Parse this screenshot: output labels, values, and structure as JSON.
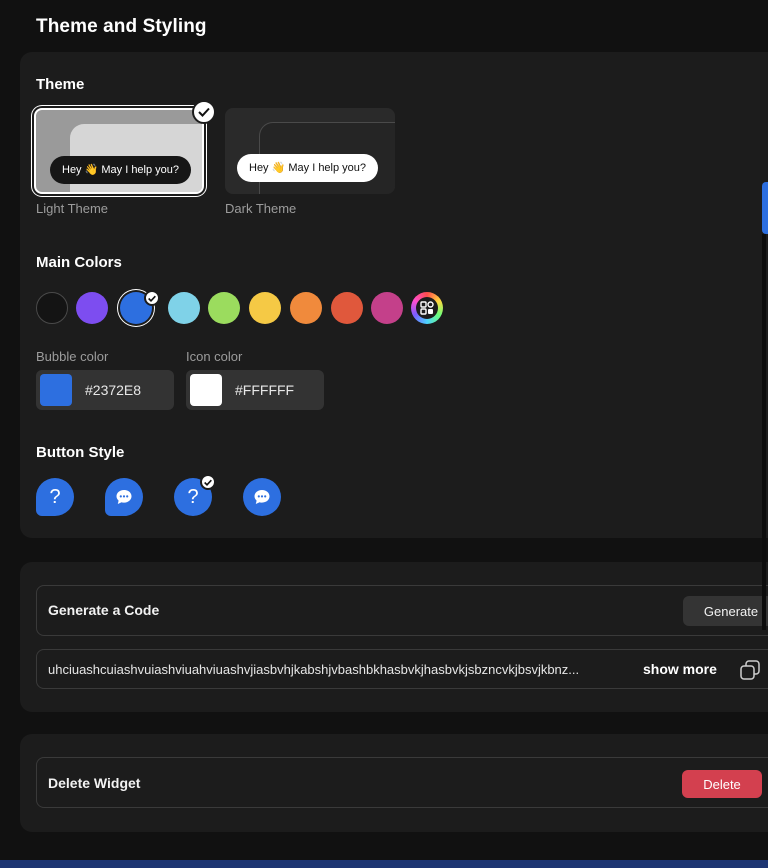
{
  "page": {
    "title": "Theme and Styling"
  },
  "theme_section": {
    "title": "Theme",
    "options": [
      {
        "label": "Light Theme",
        "bubble_text": "Hey 👋 May I help you?",
        "selected": true
      },
      {
        "label": "Dark Theme",
        "bubble_text": "Hey 👋 May I help you?",
        "selected": false
      }
    ]
  },
  "main_colors": {
    "title": "Main Colors",
    "swatches": [
      {
        "name": "black",
        "color": "#141414"
      },
      {
        "name": "purple",
        "color": "#7d4df0"
      },
      {
        "name": "blue",
        "color": "#2d6fe0",
        "selected": true
      },
      {
        "name": "light-blue",
        "color": "#7fd2e8"
      },
      {
        "name": "light-green",
        "color": "#9bdc5e"
      },
      {
        "name": "yellow",
        "color": "#f5c945"
      },
      {
        "name": "orange",
        "color": "#f08a3c"
      },
      {
        "name": "red-orange",
        "color": "#e0583c"
      },
      {
        "name": "pink",
        "color": "#c4408a"
      },
      {
        "name": "custom-color-picker",
        "icon": "palette-icon"
      }
    ],
    "bubble_color": {
      "label": "Bubble color",
      "value": "#2372E8",
      "swatch": "#2d6fe0"
    },
    "icon_color": {
      "label": "Icon color",
      "value": "#FFFFFF",
      "swatch": "#FFFFFF"
    }
  },
  "button_style": {
    "title": "Button Style",
    "options": [
      {
        "icon": "question-icon",
        "shape": "tail",
        "selected": false
      },
      {
        "icon": "chat-icon",
        "shape": "tail",
        "selected": false
      },
      {
        "icon": "question-icon",
        "shape": "round",
        "selected": true
      },
      {
        "icon": "chat-icon",
        "shape": "round",
        "selected": false
      }
    ]
  },
  "code_section": {
    "title": "Generate a Code",
    "generate_label": "Generate",
    "code_text": "uhciuashcuiashvuiashviuahviuashvjiasbvhjkabshjvbashbkhasbvkjhasbvkjsbzncvkjbsvjkbnz...",
    "show_more_label": "show more",
    "copy_icon": "copy-icon"
  },
  "delete_section": {
    "title": "Delete Widget",
    "delete_label": "Delete"
  },
  "colors": {
    "accent": "#2d6fe0",
    "danger": "#d3404f",
    "panel": "#1c1c1c",
    "background": "#111111"
  }
}
